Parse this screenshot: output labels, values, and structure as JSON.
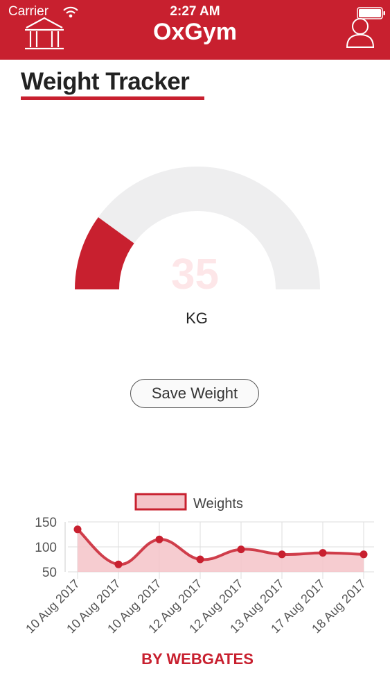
{
  "status_bar": {
    "carrier": "Carrier",
    "time": "2:27 AM"
  },
  "header": {
    "title": "OxGym",
    "left_icon": "home-icon",
    "right_icon": "user-icon"
  },
  "page": {
    "title": "Weight Tracker"
  },
  "gauge": {
    "value": "35",
    "unit": "KG",
    "fill_fraction": 0.2,
    "fill_color": "#c8202f",
    "track_color": "#eeeeef"
  },
  "save_button": {
    "label": "Save Weight"
  },
  "colors": {
    "accent": "#c8202f",
    "header_bg": "#c8202f"
  },
  "chart_data": {
    "type": "line",
    "legend": "top",
    "grid": true,
    "x": [
      "10 Aug 2017",
      "10 Aug 2017",
      "10 Aug 2017",
      "12 Aug 2017",
      "12 Aug 2017",
      "13 Aug 2017",
      "17 Aug 2017",
      "18 Aug 2017"
    ],
    "series": [
      {
        "name": "Weights",
        "values": [
          135,
          65,
          115,
          75,
          95,
          85,
          88,
          85
        ]
      }
    ],
    "yticks": [
      "150",
      "100",
      "50"
    ],
    "ylim": [
      50,
      150
    ]
  },
  "footer": {
    "text": "BY WEBGATES"
  }
}
